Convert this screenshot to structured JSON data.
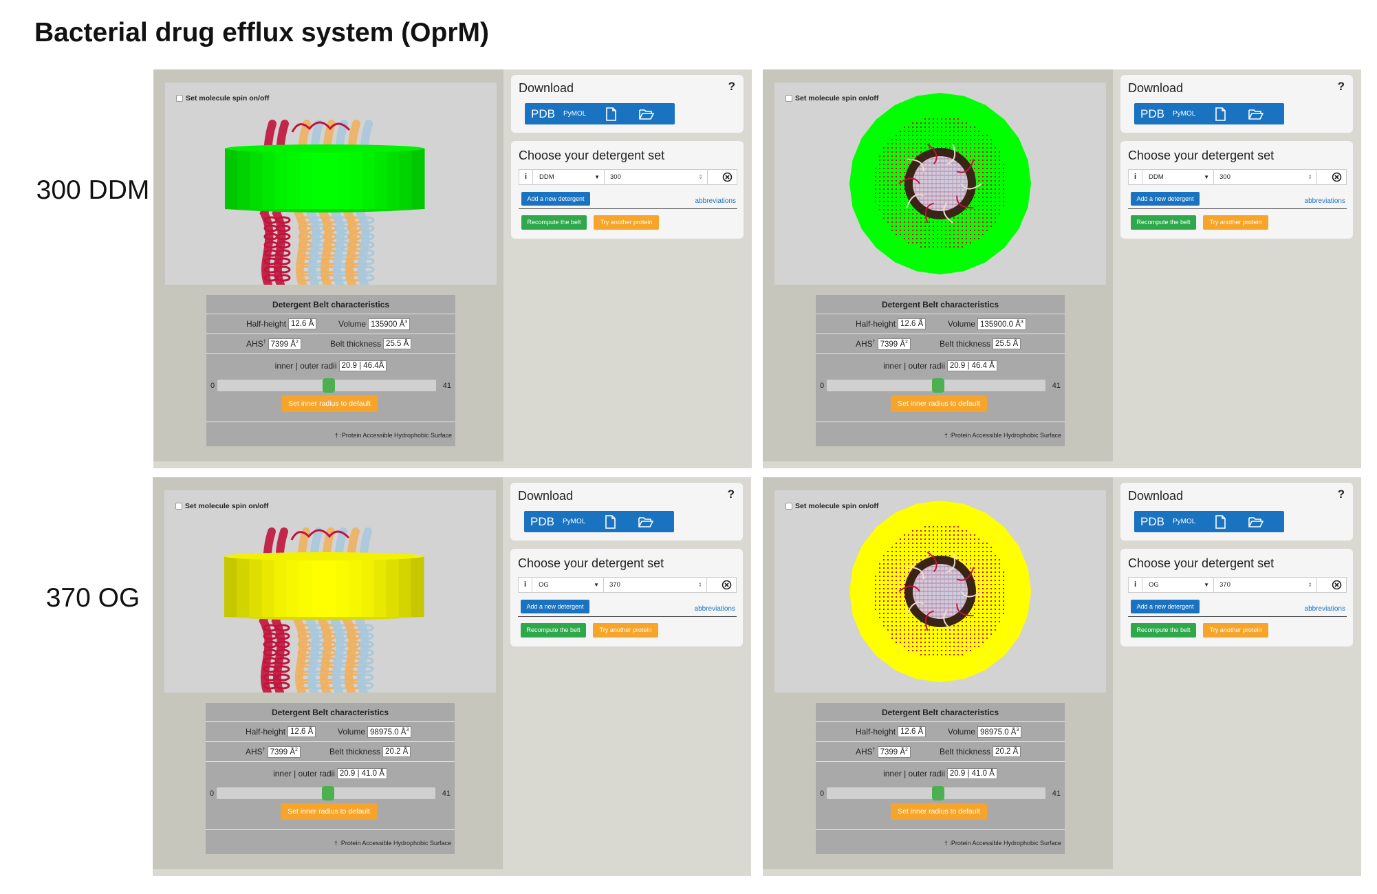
{
  "title": "Bacterial drug efflux system (OprM)",
  "row_labels": [
    "300 DDM",
    "370 OG"
  ],
  "colors": {
    "ddm_belt": "#00ff00",
    "og_belt": "#ffff00",
    "button_blue": "#1a73c0",
    "button_green": "#2ea84a",
    "button_orange": "#f7a42a",
    "slider_thumb": "#4caf50",
    "helix_red": "#c0143c",
    "helix_orange": "#f0b060",
    "helix_lightblue": "#a8c8dc"
  },
  "panels": [
    {
      "view": "side",
      "spin_label": "Set molecule spin on/off",
      "download": {
        "title": "Download",
        "help": "?",
        "pdb": "PDB",
        "pymol": "PyMOL",
        "icons": [
          "file-icon",
          "folder-open-icon"
        ]
      },
      "detergent": {
        "title": "Choose your detergent set",
        "info": "i",
        "name": "DDM",
        "count": "300",
        "add_label": "Add a new detergent",
        "abbr_label": "abbreviations",
        "recompute_label": "Recompute the belt",
        "try_label": "Try another protein"
      },
      "belt": {
        "header": "Detergent Belt characteristics",
        "half_height_label": "Half-height",
        "half_height": "12.6 Å",
        "volume_label": "Volume",
        "volume": "135900 Å",
        "volume_unit_exp": "3",
        "ahs_label": "AHS",
        "ahs_mark": "†",
        "ahs": "7399 Å",
        "ahs_unit_exp": "2",
        "thickness_label": "Belt thickness",
        "thickness": "25.5 Å",
        "radii_label": "inner | outer radii",
        "radii": "20.9 | 46.4Å",
        "slider_min": "0",
        "slider_max": "41",
        "slider_value": 20.9,
        "default_label": "Set inner radius to default",
        "footnote": "† :Protein Accessible Hydrophobic Surface"
      }
    },
    {
      "view": "top",
      "spin_label": "Set molecule spin on/off",
      "download": {
        "title": "Download",
        "help": "?",
        "pdb": "PDB",
        "pymol": "PyMOL",
        "icons": [
          "file-icon",
          "folder-open-icon"
        ]
      },
      "detergent": {
        "title": "Choose your detergent set",
        "info": "i",
        "name": "DDM",
        "count": "300",
        "add_label": "Add a new detergent",
        "abbr_label": "abbreviations",
        "recompute_label": "Recompute the belt",
        "try_label": "Try another protein"
      },
      "belt": {
        "header": "Detergent Belt characteristics",
        "half_height_label": "Half-height",
        "half_height": "12.6 Å",
        "volume_label": "Volume",
        "volume": "135900.0 Å",
        "volume_unit_exp": "3",
        "ahs_label": "AHS",
        "ahs_mark": "†",
        "ahs": "7399 Å",
        "ahs_unit_exp": "2",
        "thickness_label": "Belt thickness",
        "thickness": "25.5 Å",
        "radii_label": "inner | outer radii",
        "radii": "20.9 | 46.4 Å",
        "slider_min": "0",
        "slider_max": "41",
        "slider_value": 20.9,
        "default_label": "Set inner radius to default",
        "footnote": "† :Protein Accessible Hydrophobic Surface"
      }
    },
    {
      "view": "side",
      "spin_label": "Set molecule spin on/off",
      "download": {
        "title": "Download",
        "help": "?",
        "pdb": "PDB",
        "pymol": "PyMOL",
        "icons": [
          "file-icon",
          "folder-open-icon"
        ]
      },
      "detergent": {
        "title": "Choose your detergent set",
        "info": "i",
        "name": "OG",
        "count": "370",
        "add_label": "Add a new detergent",
        "abbr_label": "abbreviations",
        "recompute_label": "Recompute the belt",
        "try_label": "Try another protein"
      },
      "belt": {
        "header": "Detergent Belt characteristics",
        "half_height_label": "Half-height",
        "half_height": "12.6 Å",
        "volume_label": "Volume",
        "volume": "98975.0 Å",
        "volume_unit_exp": "3",
        "ahs_label": "AHS",
        "ahs_mark": "†",
        "ahs": "7399 Å",
        "ahs_unit_exp": "2",
        "thickness_label": "Belt thickness",
        "thickness": "20.2 Å",
        "radii_label": "inner | outer radii",
        "radii": "20.9 | 41.0 Å",
        "slider_min": "0",
        "slider_max": "41",
        "slider_value": 20.9,
        "default_label": "Set inner radius to default",
        "footnote": "† :Protein Accessible Hydrophobic Surface"
      }
    },
    {
      "view": "top",
      "spin_label": "Set molecule spin on/off",
      "download": {
        "title": "Download",
        "help": "?",
        "pdb": "PDB",
        "pymol": "PyMOL",
        "icons": [
          "file-icon",
          "folder-open-icon"
        ]
      },
      "detergent": {
        "title": "Choose your detergent set",
        "info": "i",
        "name": "OG",
        "count": "370",
        "add_label": "Add a new detergent",
        "abbr_label": "abbreviations",
        "recompute_label": "Recompute the belt",
        "try_label": "Try another protein"
      },
      "belt": {
        "header": "Detergent Belt characteristics",
        "half_height_label": "Half-height",
        "half_height": "12.6 Å",
        "volume_label": "Volume",
        "volume": "98975.0 Å",
        "volume_unit_exp": "3",
        "ahs_label": "AHS",
        "ahs_mark": "†",
        "ahs": "7399 Å",
        "ahs_unit_exp": "2",
        "thickness_label": "Belt thickness",
        "thickness": "20.2 Å",
        "radii_label": "inner | outer radii",
        "radii": "20.9 | 41.0 Å",
        "slider_min": "0",
        "slider_max": "41",
        "slider_value": 20.9,
        "default_label": "Set inner radius to default",
        "footnote": "† :Protein Accessible Hydrophobic Surface"
      }
    }
  ]
}
